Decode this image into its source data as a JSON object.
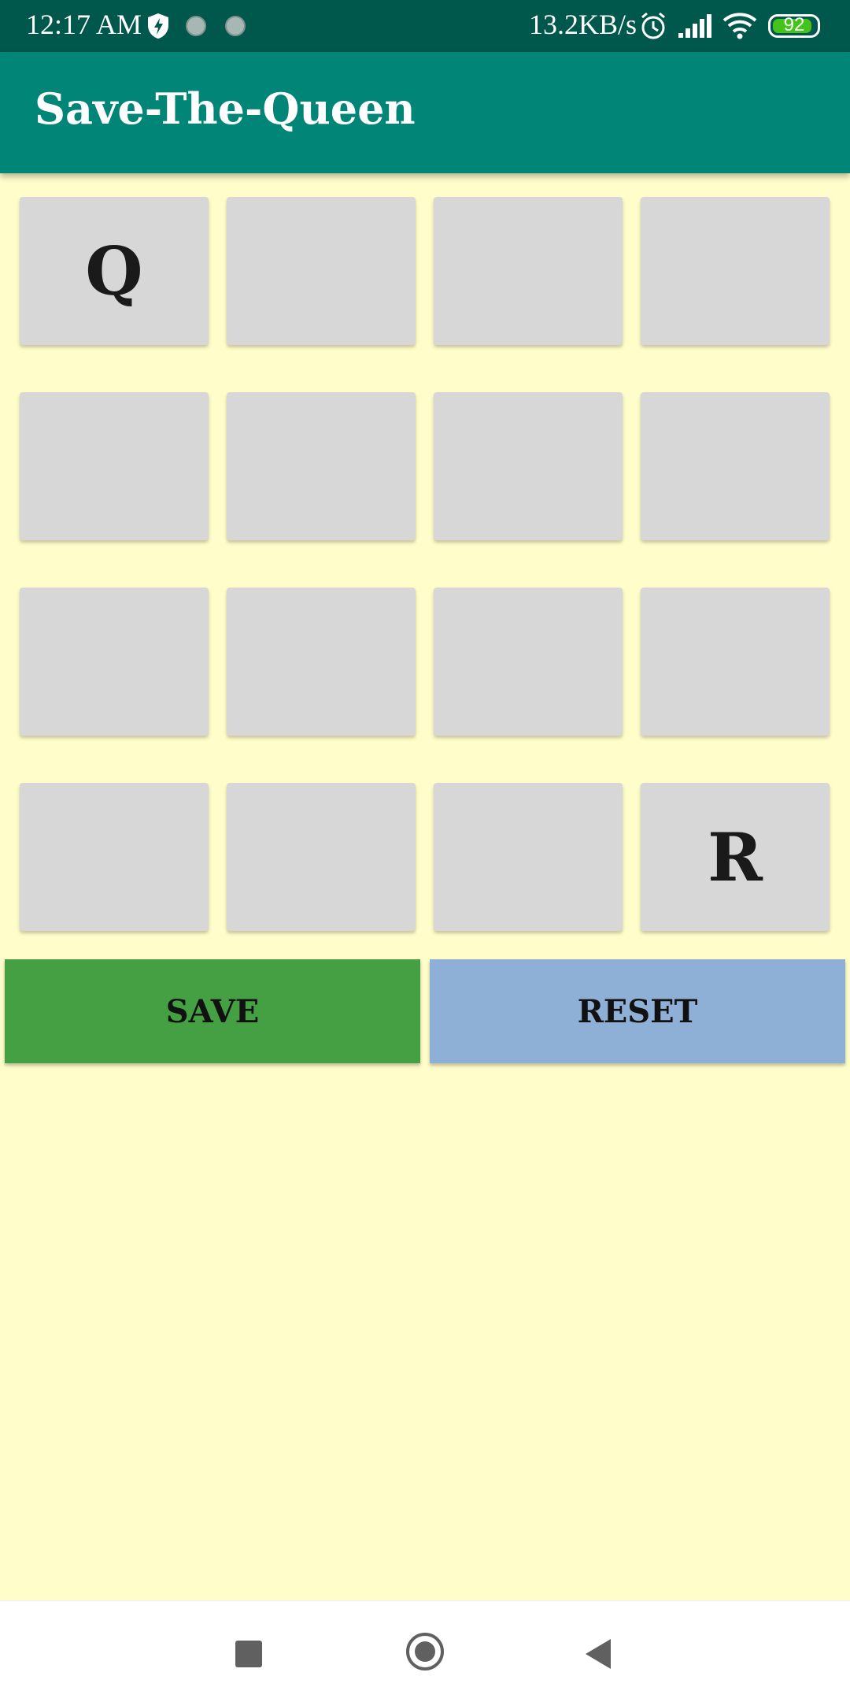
{
  "status_bar": {
    "time": "12:17 AM",
    "net_speed": "13.2KB/s",
    "battery_level": "92",
    "battery_color": "#43c31c",
    "icons": [
      "shield-icon",
      "notification-dot-icon",
      "notification-dot-icon",
      "alarm-icon",
      "cellular-signal-icon",
      "wifi-icon",
      "battery-icon"
    ]
  },
  "app_bar": {
    "title": "Save-The-Queen",
    "color": "#008577"
  },
  "board": {
    "rows": [
      [
        "Q",
        "",
        "",
        ""
      ],
      [
        "",
        "",
        "",
        ""
      ],
      [
        "",
        "",
        "",
        ""
      ],
      [
        "",
        "",
        "",
        "R"
      ]
    ]
  },
  "buttons": {
    "save_label": "SAVE",
    "reset_label": "RESET",
    "save_color": "#459f43",
    "reset_color": "#8fb0d6"
  },
  "nav_bar": {
    "icons": [
      "recents-icon",
      "home-icon",
      "back-icon"
    ]
  }
}
